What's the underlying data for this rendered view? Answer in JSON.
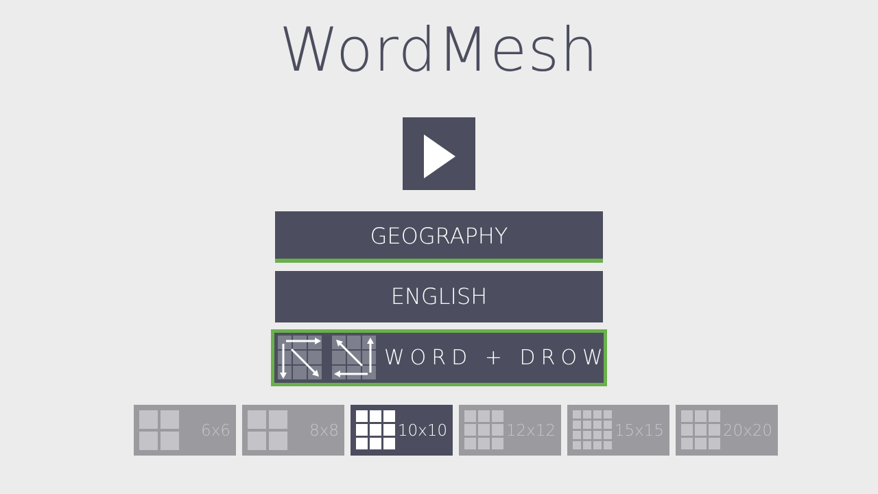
{
  "app": {
    "title": "WordMesh"
  },
  "menu": {
    "category_label": "GEOGRAPHY",
    "language_label": "ENGLISH",
    "direction_label": "WORD + DROW",
    "direction_icons": [
      "diagonal-down-arrows-grid-icon",
      "diagonal-up-arrows-grid-icon"
    ]
  },
  "grid_sizes": [
    {
      "label": "6x6",
      "cells": 2,
      "selected": false
    },
    {
      "label": "8x8",
      "cells": 2,
      "selected": false
    },
    {
      "label": "10x10",
      "cells": 3,
      "selected": true
    },
    {
      "label": "12x12",
      "cells": 3,
      "selected": false
    },
    {
      "label": "15x15",
      "cells": 4,
      "selected": false
    },
    {
      "label": "20x20",
      "cells": 3,
      "selected": false
    }
  ],
  "colors": {
    "background": "#ececec",
    "panel": "#4c4e5f",
    "accent_green": "#6ab04c",
    "disabled": "#9a9a9f"
  }
}
